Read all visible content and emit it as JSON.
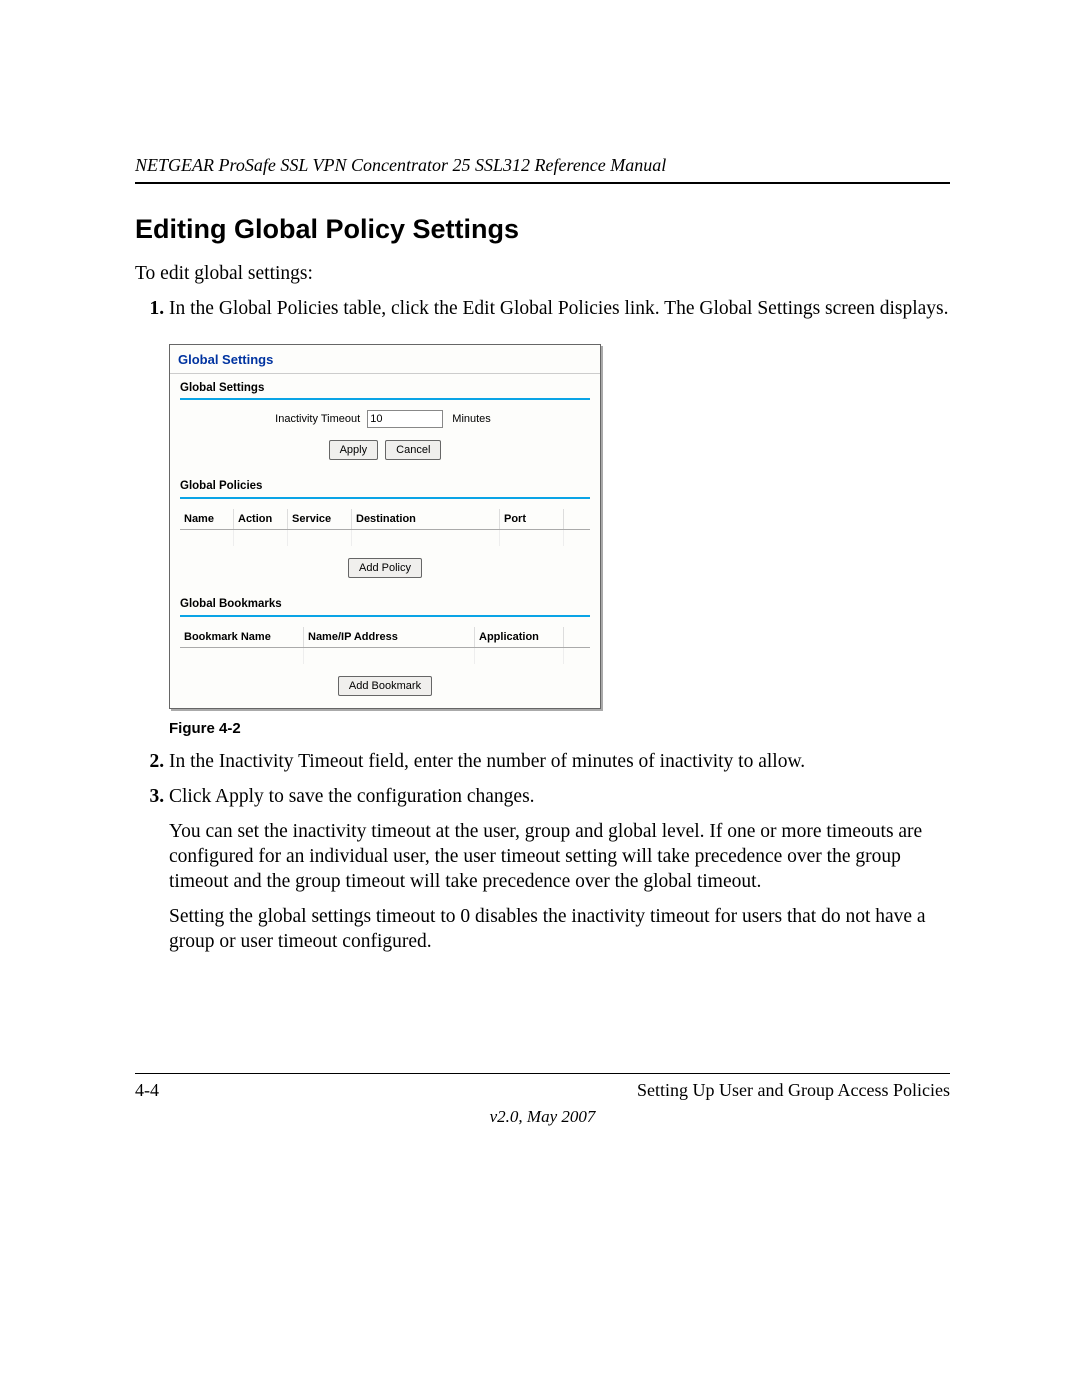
{
  "header": {
    "running_title": "NETGEAR ProSafe SSL VPN Concentrator 25 SSL312 Reference Manual"
  },
  "section": {
    "title": "Editing Global Policy Settings",
    "intro": "To edit global settings:"
  },
  "steps": {
    "s1": "In the Global Policies table, click the Edit Global Policies link. The Global Settings screen displays.",
    "s2": "In the Inactivity Timeout field, enter the number of minutes of inactivity to allow.",
    "s3": "Click Apply to save the configuration changes.",
    "s3_p1": "You can set the inactivity timeout at the user, group and global level. If one or more timeouts are configured for an individual user, the user timeout setting will take precedence over the group timeout and the group timeout will take precedence over the global timeout.",
    "s3_p2": "Setting the global settings timeout to 0 disables the inactivity timeout for users that do not have a group or user timeout configured."
  },
  "figure": {
    "caption": "Figure 4-2",
    "panel_title": "Global Settings",
    "gs": {
      "header": "Global Settings",
      "timeout_label": "Inactivity Timeout",
      "timeout_value": "10",
      "timeout_unit": "Minutes",
      "apply": "Apply",
      "cancel": "Cancel"
    },
    "gp": {
      "header": "Global Policies",
      "cols": {
        "name": "Name",
        "action": "Action",
        "service": "Service",
        "destination": "Destination",
        "port": "Port"
      },
      "add": "Add Policy"
    },
    "gb": {
      "header": "Global Bookmarks",
      "cols": {
        "bname": "Bookmark Name",
        "addr": "Name/IP Address",
        "app": "Application"
      },
      "add": "Add Bookmark"
    }
  },
  "footer": {
    "page": "4-4",
    "chapter": "Setting Up User and Group Access Policies",
    "version": "v2.0, May 2007"
  }
}
